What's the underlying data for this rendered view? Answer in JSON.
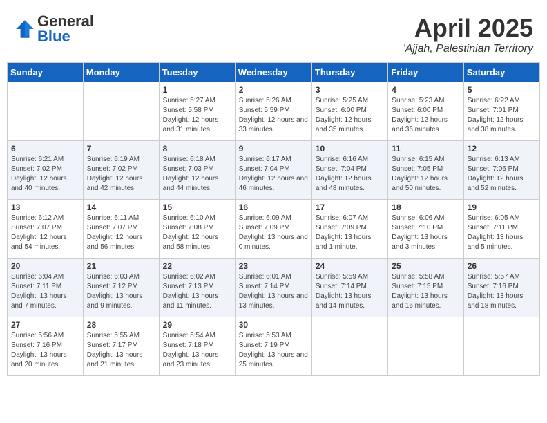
{
  "header": {
    "logo_general": "General",
    "logo_blue": "Blue",
    "month_year": "April 2025",
    "location": "'Ajjah, Palestinian Territory"
  },
  "weekdays": [
    "Sunday",
    "Monday",
    "Tuesday",
    "Wednesday",
    "Thursday",
    "Friday",
    "Saturday"
  ],
  "weeks": [
    [
      {
        "day": "",
        "sunrise": "",
        "sunset": "",
        "daylight": ""
      },
      {
        "day": "",
        "sunrise": "",
        "sunset": "",
        "daylight": ""
      },
      {
        "day": "1",
        "sunrise": "Sunrise: 5:27 AM",
        "sunset": "Sunset: 5:58 PM",
        "daylight": "Daylight: 12 hours and 31 minutes."
      },
      {
        "day": "2",
        "sunrise": "Sunrise: 5:26 AM",
        "sunset": "Sunset: 5:59 PM",
        "daylight": "Daylight: 12 hours and 33 minutes."
      },
      {
        "day": "3",
        "sunrise": "Sunrise: 5:25 AM",
        "sunset": "Sunset: 6:00 PM",
        "daylight": "Daylight: 12 hours and 35 minutes."
      },
      {
        "day": "4",
        "sunrise": "Sunrise: 5:23 AM",
        "sunset": "Sunset: 6:00 PM",
        "daylight": "Daylight: 12 hours and 36 minutes."
      },
      {
        "day": "5",
        "sunrise": "Sunrise: 6:22 AM",
        "sunset": "Sunset: 7:01 PM",
        "daylight": "Daylight: 12 hours and 38 minutes."
      }
    ],
    [
      {
        "day": "6",
        "sunrise": "Sunrise: 6:21 AM",
        "sunset": "Sunset: 7:02 PM",
        "daylight": "Daylight: 12 hours and 40 minutes."
      },
      {
        "day": "7",
        "sunrise": "Sunrise: 6:19 AM",
        "sunset": "Sunset: 7:02 PM",
        "daylight": "Daylight: 12 hours and 42 minutes."
      },
      {
        "day": "8",
        "sunrise": "Sunrise: 6:18 AM",
        "sunset": "Sunset: 7:03 PM",
        "daylight": "Daylight: 12 hours and 44 minutes."
      },
      {
        "day": "9",
        "sunrise": "Sunrise: 6:17 AM",
        "sunset": "Sunset: 7:04 PM",
        "daylight": "Daylight: 12 hours and 46 minutes."
      },
      {
        "day": "10",
        "sunrise": "Sunrise: 6:16 AM",
        "sunset": "Sunset: 7:04 PM",
        "daylight": "Daylight: 12 hours and 48 minutes."
      },
      {
        "day": "11",
        "sunrise": "Sunrise: 6:15 AM",
        "sunset": "Sunset: 7:05 PM",
        "daylight": "Daylight: 12 hours and 50 minutes."
      },
      {
        "day": "12",
        "sunrise": "Sunrise: 6:13 AM",
        "sunset": "Sunset: 7:06 PM",
        "daylight": "Daylight: 12 hours and 52 minutes."
      }
    ],
    [
      {
        "day": "13",
        "sunrise": "Sunrise: 6:12 AM",
        "sunset": "Sunset: 7:07 PM",
        "daylight": "Daylight: 12 hours and 54 minutes."
      },
      {
        "day": "14",
        "sunrise": "Sunrise: 6:11 AM",
        "sunset": "Sunset: 7:07 PM",
        "daylight": "Daylight: 12 hours and 56 minutes."
      },
      {
        "day": "15",
        "sunrise": "Sunrise: 6:10 AM",
        "sunset": "Sunset: 7:08 PM",
        "daylight": "Daylight: 12 hours and 58 minutes."
      },
      {
        "day": "16",
        "sunrise": "Sunrise: 6:09 AM",
        "sunset": "Sunset: 7:09 PM",
        "daylight": "Daylight: 13 hours and 0 minutes."
      },
      {
        "day": "17",
        "sunrise": "Sunrise: 6:07 AM",
        "sunset": "Sunset: 7:09 PM",
        "daylight": "Daylight: 13 hours and 1 minute."
      },
      {
        "day": "18",
        "sunrise": "Sunrise: 6:06 AM",
        "sunset": "Sunset: 7:10 PM",
        "daylight": "Daylight: 13 hours and 3 minutes."
      },
      {
        "day": "19",
        "sunrise": "Sunrise: 6:05 AM",
        "sunset": "Sunset: 7:11 PM",
        "daylight": "Daylight: 13 hours and 5 minutes."
      }
    ],
    [
      {
        "day": "20",
        "sunrise": "Sunrise: 6:04 AM",
        "sunset": "Sunset: 7:11 PM",
        "daylight": "Daylight: 13 hours and 7 minutes."
      },
      {
        "day": "21",
        "sunrise": "Sunrise: 6:03 AM",
        "sunset": "Sunset: 7:12 PM",
        "daylight": "Daylight: 13 hours and 9 minutes."
      },
      {
        "day": "22",
        "sunrise": "Sunrise: 6:02 AM",
        "sunset": "Sunset: 7:13 PM",
        "daylight": "Daylight: 13 hours and 11 minutes."
      },
      {
        "day": "23",
        "sunrise": "Sunrise: 6:01 AM",
        "sunset": "Sunset: 7:14 PM",
        "daylight": "Daylight: 13 hours and 13 minutes."
      },
      {
        "day": "24",
        "sunrise": "Sunrise: 5:59 AM",
        "sunset": "Sunset: 7:14 PM",
        "daylight": "Daylight: 13 hours and 14 minutes."
      },
      {
        "day": "25",
        "sunrise": "Sunrise: 5:58 AM",
        "sunset": "Sunset: 7:15 PM",
        "daylight": "Daylight: 13 hours and 16 minutes."
      },
      {
        "day": "26",
        "sunrise": "Sunrise: 5:57 AM",
        "sunset": "Sunset: 7:16 PM",
        "daylight": "Daylight: 13 hours and 18 minutes."
      }
    ],
    [
      {
        "day": "27",
        "sunrise": "Sunrise: 5:56 AM",
        "sunset": "Sunset: 7:16 PM",
        "daylight": "Daylight: 13 hours and 20 minutes."
      },
      {
        "day": "28",
        "sunrise": "Sunrise: 5:55 AM",
        "sunset": "Sunset: 7:17 PM",
        "daylight": "Daylight: 13 hours and 21 minutes."
      },
      {
        "day": "29",
        "sunrise": "Sunrise: 5:54 AM",
        "sunset": "Sunset: 7:18 PM",
        "daylight": "Daylight: 13 hours and 23 minutes."
      },
      {
        "day": "30",
        "sunrise": "Sunrise: 5:53 AM",
        "sunset": "Sunset: 7:19 PM",
        "daylight": "Daylight: 13 hours and 25 minutes."
      },
      {
        "day": "",
        "sunrise": "",
        "sunset": "",
        "daylight": ""
      },
      {
        "day": "",
        "sunrise": "",
        "sunset": "",
        "daylight": ""
      },
      {
        "day": "",
        "sunrise": "",
        "sunset": "",
        "daylight": ""
      }
    ]
  ]
}
